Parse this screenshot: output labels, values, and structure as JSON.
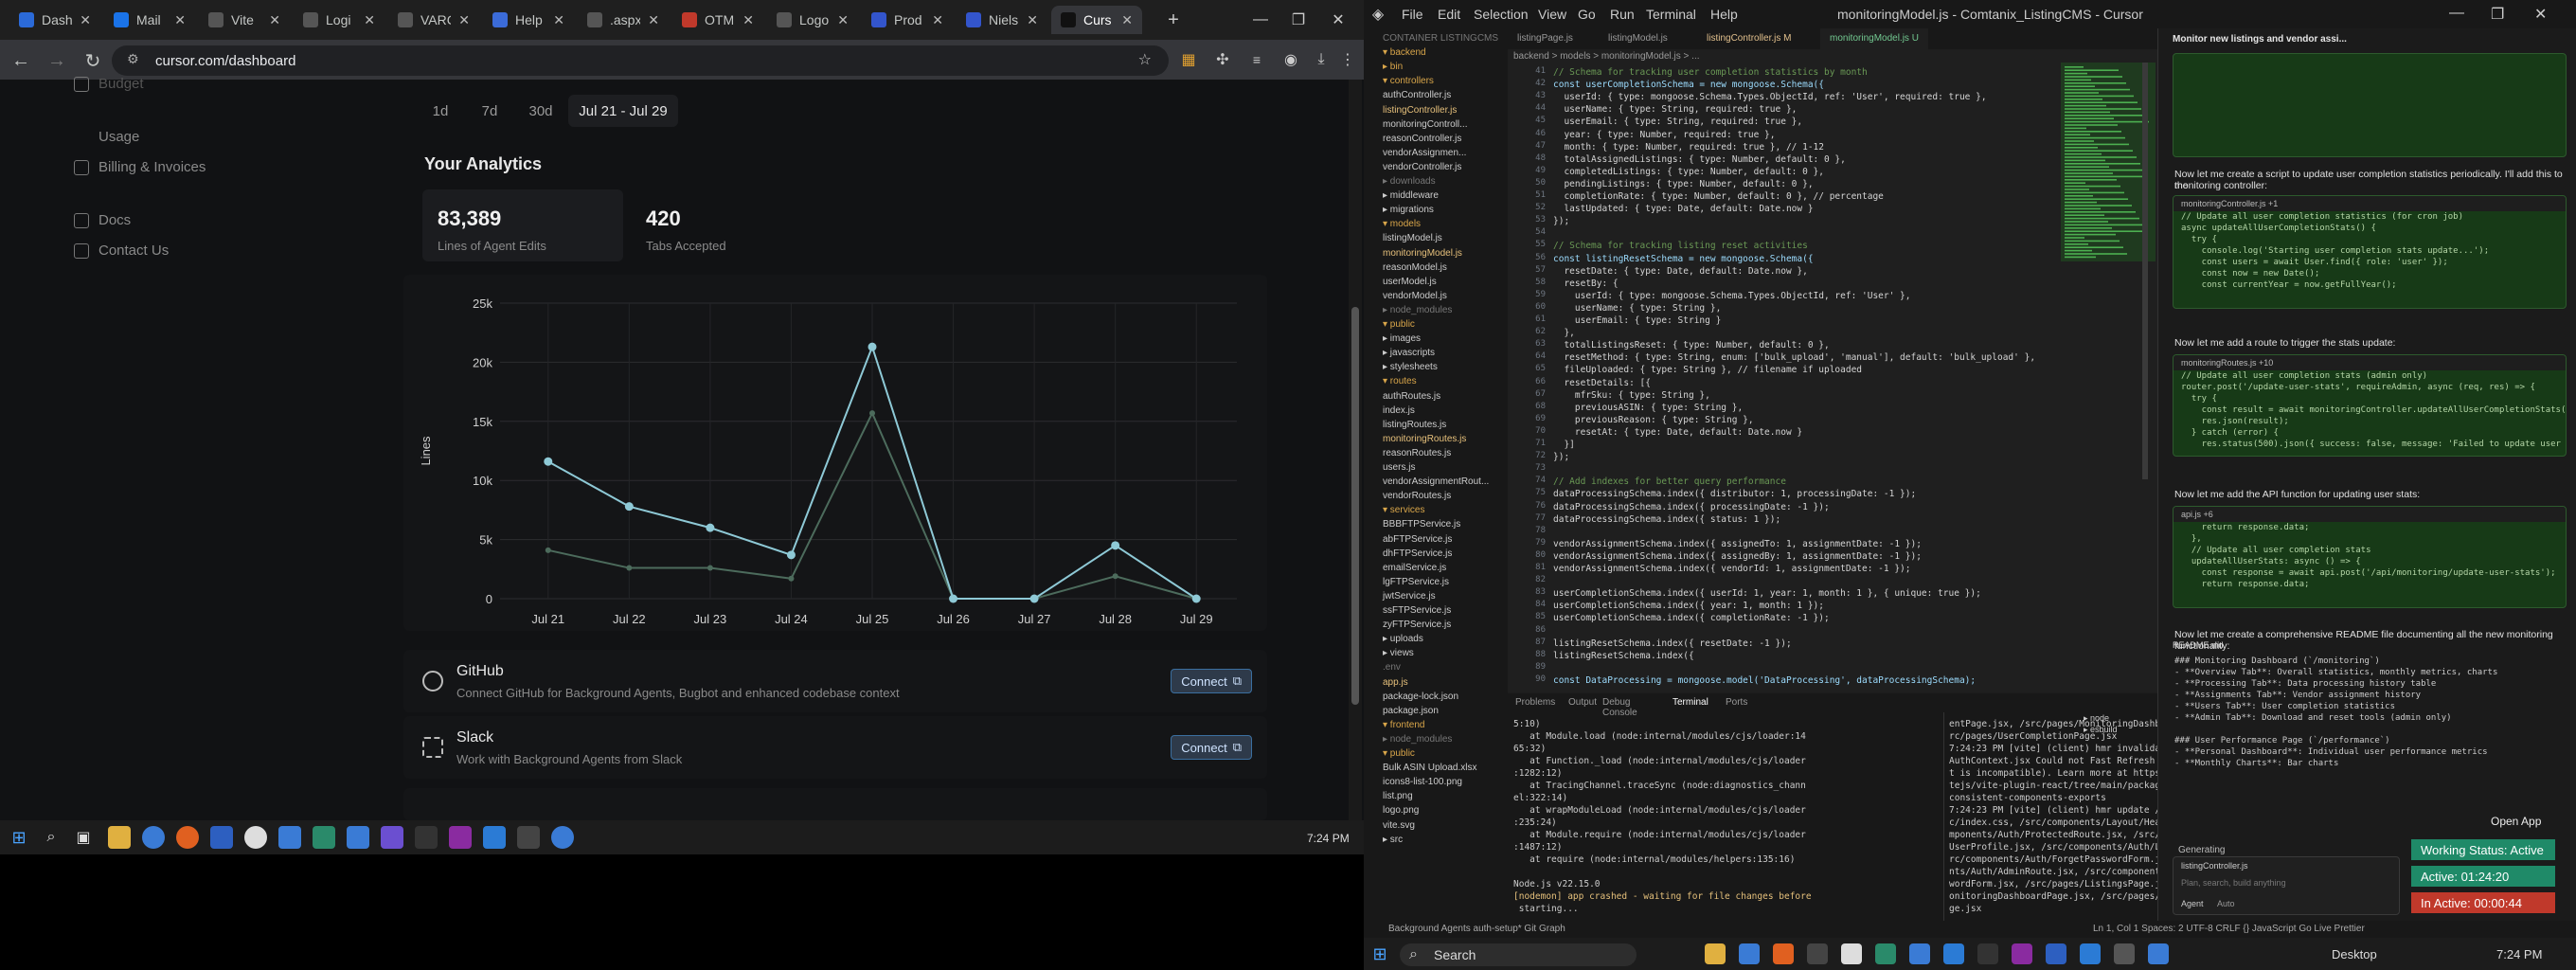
{
  "browser": {
    "tabs": [
      {
        "label": "Dash",
        "color": "#2b6ad8"
      },
      {
        "label": "Mail",
        "color": "#1a73e8"
      },
      {
        "label": "Vite",
        "color": "#555"
      },
      {
        "label": "Logi",
        "color": "#555"
      },
      {
        "label": "VARC",
        "color": "#555"
      },
      {
        "label": "Help",
        "color": "#3b6bd8"
      },
      {
        "label": ".aspx",
        "color": "#555"
      },
      {
        "label": "OTM",
        "color": "#c0392b"
      },
      {
        "label": "Logo",
        "color": "#555"
      },
      {
        "label": "Prod",
        "color": "#3355cc"
      },
      {
        "label": "Niels",
        "color": "#3355cc"
      },
      {
        "label": "Curs",
        "color": "#111"
      }
    ],
    "url": "cursor.com/dashboard",
    "time": "7:24 PM"
  },
  "dashboard": {
    "sidebar": [
      "Budget",
      "Usage",
      "Billing & Invoices",
      "Docs",
      "Contact Us"
    ],
    "ranges": [
      "1d",
      "7d",
      "30d",
      "Jul 21 - Jul 29"
    ],
    "title": "Your Analytics",
    "stats": [
      {
        "value": "83,389",
        "label": "Lines of Agent Edits"
      },
      {
        "value": "420",
        "label": "Tabs Accepted"
      }
    ],
    "integrations": [
      {
        "name": "GitHub",
        "desc": "Connect GitHub for Background Agents, Bugbot and enhanced codebase context",
        "button": "Connect"
      },
      {
        "name": "Slack",
        "desc": "Work with Background Agents from Slack",
        "button": "Connect"
      }
    ]
  },
  "chart_data": {
    "type": "line",
    "ylabel": "Lines",
    "ylim": [
      0,
      25000
    ],
    "yticks": [
      "0",
      "5k",
      "10k",
      "15k",
      "20k",
      "25k"
    ],
    "categories": [
      "Jul 21",
      "Jul 22",
      "Jul 23",
      "Jul 24",
      "Jul 25",
      "Jul 26",
      "Jul 27",
      "Jul 28",
      "Jul 29"
    ],
    "series": [
      {
        "values": [
          11600,
          7800,
          6000,
          3700,
          21300,
          0,
          0,
          4500,
          0
        ],
        "color": "#8ec9d6"
      },
      {
        "values": [
          4100,
          2600,
          2600,
          1700,
          15700,
          0,
          0,
          1900,
          0
        ],
        "color": "#4c6b5c"
      }
    ]
  },
  "cursor": {
    "window_title": "monitoringModel.js - Comtanix_ListingCMS - Cursor",
    "menus": [
      "File",
      "Edit",
      "Selection",
      "View",
      "Go",
      "Run",
      "Terminal",
      "Help"
    ],
    "editor_tabs": [
      "listingPage.js",
      "listingModel.js",
      "listingController.js M",
      "monitoringModel.js U"
    ],
    "breadcrumb": "backend > models > monitoringModel.js > ...",
    "explorer": [
      {
        "t": "CONTAINER LISTINGCMS",
        "k": "dim"
      },
      {
        "t": "▾ backend",
        "k": "f"
      },
      {
        "t": "  ▸ bin",
        "k": "f"
      },
      {
        "t": "  ▾ controllers",
        "k": "f"
      },
      {
        "t": "     authController.js",
        "k": ""
      },
      {
        "t": "     listingController.js",
        "k": "m"
      },
      {
        "t": "     monitoringControll...",
        "k": ""
      },
      {
        "t": "     reasonController.js",
        "k": ""
      },
      {
        "t": "     vendorAssignmen...",
        "k": ""
      },
      {
        "t": "     vendorController.js",
        "k": ""
      },
      {
        "t": "  ▸ downloads",
        "k": "dim"
      },
      {
        "t": "  ▸ middleware",
        "k": ""
      },
      {
        "t": "  ▸ migrations",
        "k": ""
      },
      {
        "t": "  ▾ models",
        "k": "f"
      },
      {
        "t": "     listingModel.js",
        "k": ""
      },
      {
        "t": "     monitoringModel.js",
        "k": "m"
      },
      {
        "t": "     reasonModel.js",
        "k": ""
      },
      {
        "t": "     userModel.js",
        "k": ""
      },
      {
        "t": "     vendorModel.js",
        "k": ""
      },
      {
        "t": "  ▸ node_modules",
        "k": "dim"
      },
      {
        "t": "  ▾ public",
        "k": "f"
      },
      {
        "t": "    ▸ images",
        "k": ""
      },
      {
        "t": "    ▸ javascripts",
        "k": ""
      },
      {
        "t": "    ▸ stylesheets",
        "k": ""
      },
      {
        "t": "  ▾ routes",
        "k": "f"
      },
      {
        "t": "     authRoutes.js",
        "k": ""
      },
      {
        "t": "     index.js",
        "k": ""
      },
      {
        "t": "     listingRoutes.js",
        "k": ""
      },
      {
        "t": "     monitoringRoutes.js",
        "k": "m"
      },
      {
        "t": "     reasonRoutes.js",
        "k": ""
      },
      {
        "t": "     users.js",
        "k": ""
      },
      {
        "t": "     vendorAssignmentRout...",
        "k": ""
      },
      {
        "t": "     vendorRoutes.js",
        "k": ""
      },
      {
        "t": "  ▾ services",
        "k": "f"
      },
      {
        "t": "     BBBFTPService.js",
        "k": ""
      },
      {
        "t": "     abFTPService.js",
        "k": ""
      },
      {
        "t": "     dhFTPService.js",
        "k": ""
      },
      {
        "t": "     emailService.js",
        "k": ""
      },
      {
        "t": "     lgFTPService.js",
        "k": ""
      },
      {
        "t": "     jwtService.js",
        "k": ""
      },
      {
        "t": "     ssFTPService.js",
        "k": ""
      },
      {
        "t": "     zyFTPService.js",
        "k": ""
      },
      {
        "t": "  ▸ uploads",
        "k": ""
      },
      {
        "t": "  ▸ views",
        "k": ""
      },
      {
        "t": "    .env",
        "k": "dim"
      },
      {
        "t": "    app.js",
        "k": "m"
      },
      {
        "t": "    package-lock.json",
        "k": ""
      },
      {
        "t": "    package.json",
        "k": ""
      },
      {
        "t": "▾ frontend",
        "k": "f"
      },
      {
        "t": "  ▸ node_modules",
        "k": "dim"
      },
      {
        "t": "  ▾ public",
        "k": "f"
      },
      {
        "t": "     Bulk ASIN Upload.xlsx",
        "k": ""
      },
      {
        "t": "     icons8-list-100.png",
        "k": ""
      },
      {
        "t": "     list.png",
        "k": ""
      },
      {
        "t": "     logo.png",
        "k": ""
      },
      {
        "t": "     vite.svg",
        "k": ""
      },
      {
        "t": "  ▸ src",
        "k": ""
      }
    ],
    "code_start": 41,
    "code": [
      "// Schema for tracking user completion statistics by month",
      "const userCompletionSchema = new mongoose.Schema({",
      "  userId: { type: mongoose.Schema.Types.ObjectId, ref: 'User', required: true },",
      "  userName: { type: String, required: true },",
      "  userEmail: { type: String, required: true },",
      "  year: { type: Number, required: true },",
      "  month: { type: Number, required: true }, // 1-12",
      "  totalAssignedListings: { type: Number, default: 0 },",
      "  completedListings: { type: Number, default: 0 },",
      "  pendingListings: { type: Number, default: 0 },",
      "  completionRate: { type: Number, default: 0 }, // percentage",
      "  lastUpdated: { type: Date, default: Date.now }",
      "});",
      "",
      "// Schema for tracking listing reset activities",
      "const listingResetSchema = new mongoose.Schema({",
      "  resetDate: { type: Date, default: Date.now },",
      "  resetBy: {",
      "    userId: { type: mongoose.Schema.Types.ObjectId, ref: 'User' },",
      "    userName: { type: String },",
      "    userEmail: { type: String }",
      "  },",
      "  totalListingsReset: { type: Number, default: 0 },",
      "  resetMethod: { type: String, enum: ['bulk_upload', 'manual'], default: 'bulk_upload' },",
      "  fileUploaded: { type: String }, // filename if uploaded",
      "  resetDetails: [{",
      "    mfrSku: { type: String },",
      "    previousASIN: { type: String },",
      "    previousReason: { type: String },",
      "    resetAt: { type: Date, default: Date.now }",
      "  }]",
      "});",
      "",
      "// Add indexes for better query performance",
      "dataProcessingSchema.index({ distributor: 1, processingDate: -1 });",
      "dataProcessingSchema.index({ processingDate: -1 });",
      "dataProcessingSchema.index({ status: 1 });",
      "",
      "vendorAssignmentSchema.index({ assignedTo: 1, assignmentDate: -1 });",
      "vendorAssignmentSchema.index({ assignedBy: 1, assignmentDate: -1 });",
      "vendorAssignmentSchema.index({ vendorId: 1, assignmentDate: -1 });",
      "",
      "userCompletionSchema.index({ userId: 1, year: 1, month: 1 }, { unique: true });",
      "userCompletionSchema.index({ year: 1, month: 1 });",
      "userCompletionSchema.index({ completionRate: -1 });",
      "",
      "listingResetSchema.index({ resetDate: -1 });",
      "listingResetSchema.index({",
      "",
      "const DataProcessing = mongoose.model('DataProcessing', dataProcessingSchema);"
    ],
    "panel_tabs": [
      "Problems",
      "Output",
      "Debug Console",
      "Terminal",
      "Ports"
    ],
    "term_left": [
      "5:10)",
      "   at Module.load (node:internal/modules/cjs/loader:14",
      "65:32)",
      "   at Function._load (node:internal/modules/cjs/loader",
      ":1282:12)",
      "   at TracingChannel.traceSync (node:diagnostics_chann",
      "el:322:14)",
      "   at wrapModuleLoad (node:internal/modules/cjs/loader",
      ":235:24)",
      "   at Module.require (node:internal/modules/cjs/loader",
      ":1487:12)",
      "   at require (node:internal/modules/helpers:135:16)",
      "",
      "Node.js v22.15.0",
      "[nodemon] app crashed - waiting for file changes before",
      " starting..."
    ],
    "term_right": [
      "entPage.jsx, /src/pages/MonitoringDashboardPage.jsx, /s",
      "rc/pages/UserCompletionPage.jsx",
      "7:24:23 PM [vite] (client) hmr invalidate /src/context/",
      "AuthContext.jsx Could not Fast Refresh (\"useAuth\" expor",
      "t is incompatible). Learn more at https://github.com/vi",
      "tejs/vite-plugin-react/tree/main/packages/plugin-react#",
      "consistent-components-exports",
      "7:24:23 PM [vite] (client) hmr update /src/App.jsx, /sr",
      "c/index.css, /src/components/Layout/Header.jsx, /src/co",
      "mponents/Auth/ProtectedRoute.jsx, /src/components/Auth/",
      "UserProfile.jsx, /src/components/Auth/LoginForm.jsx, /s",
      "rc/components/Auth/ForgetPasswordForm.jsx, /src/compone",
      "nts/Auth/AdminRoute.jsx, /src/components/Auth/ResetPass",
      "wordForm.jsx, /src/pages/ListingsPage.jsx, /src/pages/M",
      "onitoringDashboardPage.jsx, /src/pages/UserCompletionPa",
      "ge.jsx"
    ],
    "chat": {
      "title": "Monitor new listings and vendor assi...",
      "texts": [
        "Now let me create a script to update user completion statistics periodically. I'll add this to the",
        "monitoring controller:",
        "Now let me add a route to trigger the stats update:",
        "Now let me add the API function for updating user stats:",
        "Now let me create a comprehensive README file documenting all the new monitoring functionality:"
      ],
      "cards": [
        {
          "file": "monitoringController.js +1",
          "lines": [
            "// Update all user completion statistics (for cron job)",
            "async updateAllUserCompletionStats() {",
            "  try {",
            "    console.log('Starting user completion stats update...');",
            "",
            "    const users = await User.find({ role: 'user' });",
            "    const now = new Date();",
            "    const currentYear = now.getFullYear();"
          ]
        },
        {
          "file": "monitoringRoutes.js +10",
          "lines": [
            "// Update all user completion stats (admin only)",
            "router.post('/update-user-stats', requireAdmin, async (req, res) => {",
            "  try {",
            "    const result = await monitoringController.updateAllUserCompletionStats();",
            "    res.json(result);",
            "  } catch (error) {",
            "    res.status(500).json({ success: false, message: 'Failed to update user stats' });"
          ]
        },
        {
          "file": "api.js +6",
          "lines": [
            "    return response.data;",
            "  },",
            "",
            "  // Update all user completion stats",
            "  updateAllUserStats: async () => {",
            "    const response = await api.post('/api/monitoring/update-user-stats');",
            "    return response.data;"
          ]
        }
      ],
      "readme": [
        "### Monitoring Dashboard (`/monitoring`)",
        "- **Overview Tab**: Overall statistics, monthly metrics, charts",
        "- **Processing Tab**: Data processing history table",
        "- **Assignments Tab**: Vendor assignment history",
        "- **Users Tab**: User completion statistics",
        "- **Admin Tab**: Download and reset tools (admin only)",
        "",
        "### User Performance Page (`/performance`)",
        "- **Personal Dashboard**: Individual user performance metrics",
        "- **Monthly Charts**: Bar charts"
      ],
      "generating": "Generating",
      "input_file": "listingController.js",
      "input_placeholder": "Plan, search, build anything",
      "agent_label": "Agent",
      "auto_label": "Auto"
    },
    "status_left": "Background Agents   auth-setup*   Git Graph",
    "status_right": "Ln 1, Col 1   Spaces: 2   UTF-8   CRLF   {} JavaScript   Go Live   Prettier",
    "open_app": "Open App",
    "badges": [
      {
        "text": "Working Status: Active",
        "color": "#1f8a68"
      },
      {
        "text": "Active: 01:24:20",
        "color": "#1f8a68"
      },
      {
        "text": "In Active: 00:00:44",
        "color": "#c0392b"
      }
    ],
    "search_label": "Search",
    "desktop_label": "Desktop",
    "time": "7:24 PM"
  }
}
